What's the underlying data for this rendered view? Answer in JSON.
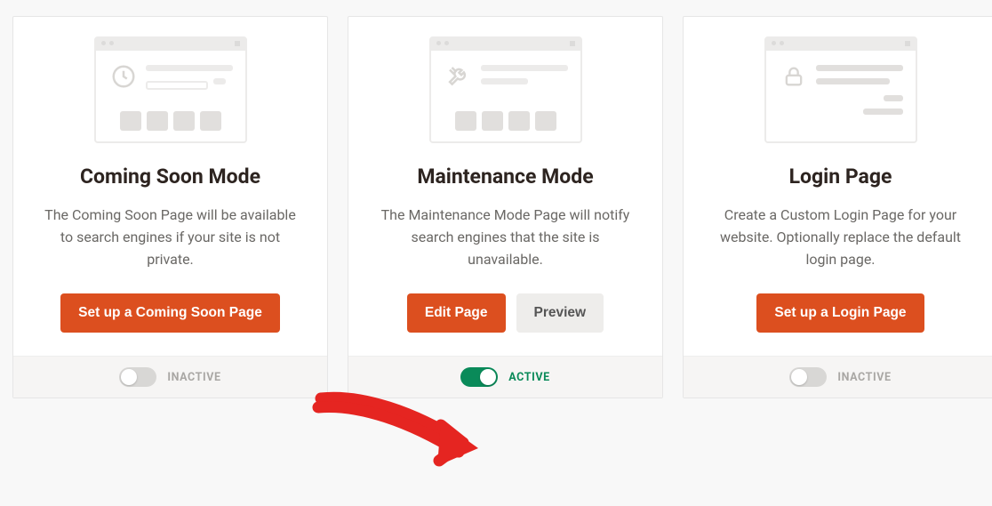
{
  "cards": [
    {
      "title": "Coming Soon Mode",
      "description": "The Coming Soon Page will be available to search engines if your site is not private.",
      "primary_button": "Set up a Coming Soon Page",
      "status": "INACTIVE",
      "active": false,
      "icon": "clock"
    },
    {
      "title": "Maintenance Mode",
      "description": "The Maintenance Mode Page will notify search engines that the site is unavailable.",
      "primary_button": "Edit Page",
      "secondary_button": "Preview",
      "status": "ACTIVE",
      "active": true,
      "icon": "tools"
    },
    {
      "title": "Login Page",
      "description": "Create a Custom Login Page for your website. Optionally replace the default login page.",
      "primary_button": "Set up a Login Page",
      "status": "INACTIVE",
      "active": false,
      "icon": "lock"
    }
  ]
}
